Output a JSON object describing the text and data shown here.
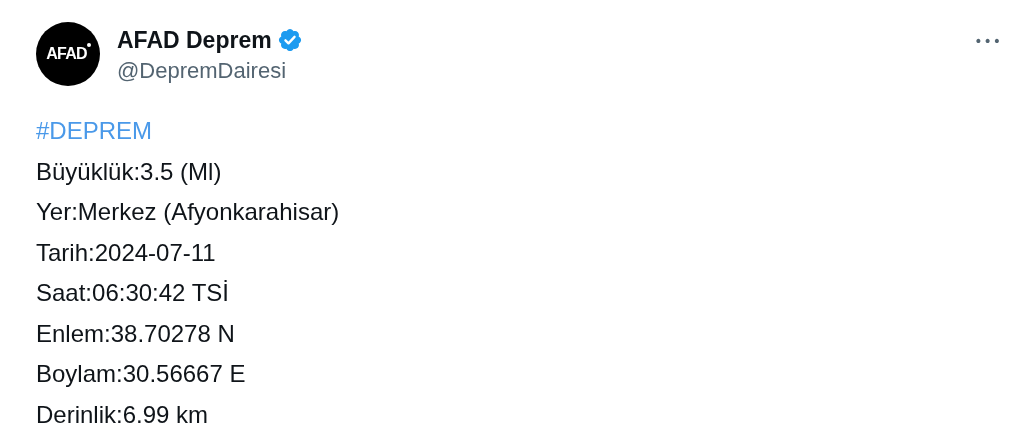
{
  "author": {
    "avatar_text": "AFAD",
    "name": "AFAD Deprem",
    "verified": true,
    "handle": "@DepremDairesi"
  },
  "more_button": "•••",
  "body": [
    {
      "kind": "hashtag",
      "text": "#DEPREM"
    },
    {
      "kind": "line",
      "text": "Büyüklük:3.5 (Ml)"
    },
    {
      "kind": "line",
      "text": "Yer:Merkez (Afyonkarahisar)"
    },
    {
      "kind": "line",
      "text": "Tarih:2024-07-11"
    },
    {
      "kind": "line",
      "text": "Saat:06:30:42 TSİ"
    },
    {
      "kind": "line",
      "text": "Enlem:38.70278 N"
    },
    {
      "kind": "line",
      "text": "Boylam:30.56667 E"
    },
    {
      "kind": "line",
      "text": "Derinlik:6.99 km"
    }
  ]
}
